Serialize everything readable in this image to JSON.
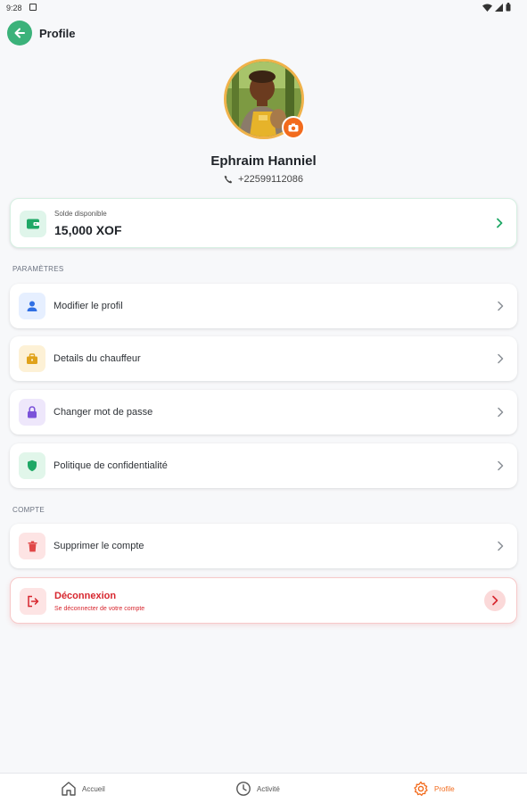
{
  "status_bar": {
    "time": "9:28"
  },
  "header": {
    "title": "Profile"
  },
  "profile": {
    "name": "Ephraim Hanniel",
    "phone": "+22599112086"
  },
  "balance": {
    "label": "Solde disponible",
    "value": "15,000 XOF"
  },
  "sections": {
    "parametres": "PARAMÈTRES",
    "compte": "COMPTE"
  },
  "settings_items": [
    {
      "label": "Modifier le profil",
      "icon": "user-icon",
      "color": "#2f6fe4",
      "bg": "#e6efff"
    },
    {
      "label": "Details du chauffeur",
      "icon": "briefcase-icon",
      "color": "#e0a21a",
      "bg": "#fdf1d6"
    },
    {
      "label": "Changer mot de passe",
      "icon": "lock-icon",
      "color": "#7b52d9",
      "bg": "#eee7fb"
    },
    {
      "label": "Politique de confidentialité",
      "icon": "shield-icon",
      "color": "#1fa866",
      "bg": "#e1f6ea"
    }
  ],
  "account_items": [
    {
      "label": "Supprimer le compte",
      "icon": "trash-icon",
      "color": "#e04646",
      "bg": "#fde4e4"
    }
  ],
  "logout": {
    "title": "Déconnexion",
    "subtitle": "Se déconnecter de votre compte"
  },
  "bottom_nav": [
    {
      "label": "Accueil",
      "icon": "home-icon",
      "active": false
    },
    {
      "label": "Activité",
      "icon": "clock-icon",
      "active": false
    },
    {
      "label": "Profile",
      "icon": "gear-icon",
      "active": true
    }
  ],
  "colors": {
    "accent": "#f26b1d",
    "green": "#3bb27a",
    "danger": "#d7262e"
  }
}
